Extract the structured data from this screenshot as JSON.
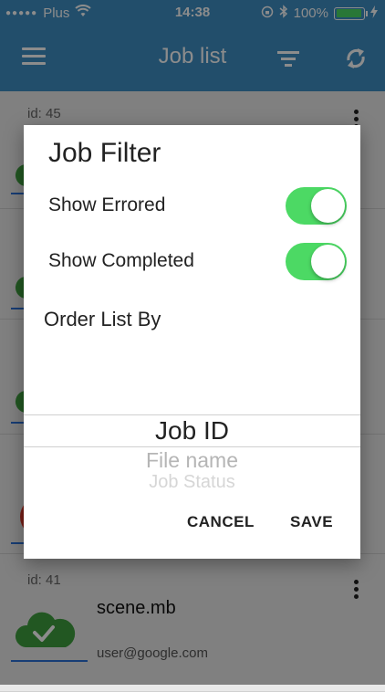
{
  "status_bar": {
    "carrier": "Plus",
    "time": "14:38",
    "battery": "100%",
    "signal_dots": "●●●●●"
  },
  "app_bar": {
    "title": "Job list",
    "menu_icon": "hamburger-menu-icon",
    "filter_icon": "filter-icon",
    "refresh_icon": "refresh-icon"
  },
  "jobs": [
    {
      "id": "id: 45"
    },
    {
      "id": "id: 41",
      "name": "scene.mb",
      "user": "user@google.com",
      "status_icon": "cloud-check-icon"
    }
  ],
  "dialog": {
    "title": "Job Filter",
    "toggles": [
      {
        "label": "Show Errored",
        "on": true
      },
      {
        "label": "Show Completed",
        "on": true
      }
    ],
    "order_label": "Order List By",
    "order_options": [
      "Job ID",
      "File name",
      "Job Status"
    ],
    "selected_option": "Job ID",
    "cancel_label": "CANCEL",
    "save_label": "SAVE"
  },
  "colors": {
    "header": "#3f8fc4",
    "toggle_on": "#4cd964",
    "status_green": "#3e9e3e",
    "status_red": "#d93a2b",
    "accent_line": "#2a6fd6"
  }
}
